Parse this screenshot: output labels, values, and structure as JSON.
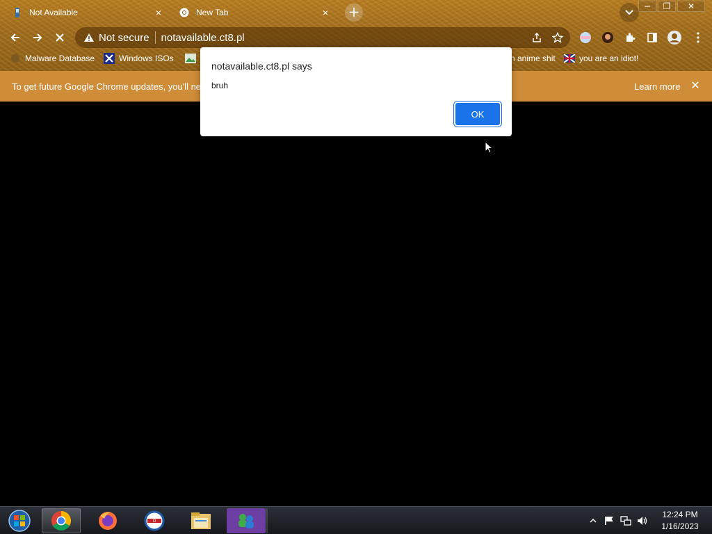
{
  "tabs": [
    {
      "label": "Not Available",
      "favicon": "ct8-favicon",
      "active": true
    },
    {
      "label": "New Tab",
      "favicon": "chrome-icon",
      "active": false
    }
  ],
  "tab_close_glyph": "×",
  "new_tab_glyph": "+",
  "window_controls": {
    "minimize": "−",
    "restore": "❐",
    "close": "✕"
  },
  "address_bar": {
    "security_label": "Not secure",
    "url": "notavailable.ct8.pl"
  },
  "bookmarks": [
    {
      "label": "Malware Database",
      "icon": "malware-icon"
    },
    {
      "label": "Windows ISOs",
      "icon": "x-icon"
    },
    {
      "label": "",
      "icon": "image-icon"
    },
    {
      "label": "n anime shit",
      "icon": ""
    },
    {
      "label": "you are an idiot!",
      "icon": "flag-icon"
    }
  ],
  "infobar": {
    "message": "To get future Google Chrome updates, you'll nee",
    "learn_more": "Learn more",
    "close": "✕"
  },
  "dialog": {
    "title": "notavailable.ct8.pl says",
    "message": "bruh",
    "ok_label": "OK"
  },
  "taskbar": {
    "items": [
      "start-orb",
      "chrome",
      "firefox",
      "opera-outlook",
      "file-explorer",
      "messenger"
    ],
    "clock_time": "12:24 PM",
    "clock_date": "1/16/2023"
  },
  "colors": {
    "chrome_theme": "#a06c1e",
    "infobar": "#cf8d39",
    "ok_button": "#1a73e8",
    "taskbar": "#1f2228"
  }
}
